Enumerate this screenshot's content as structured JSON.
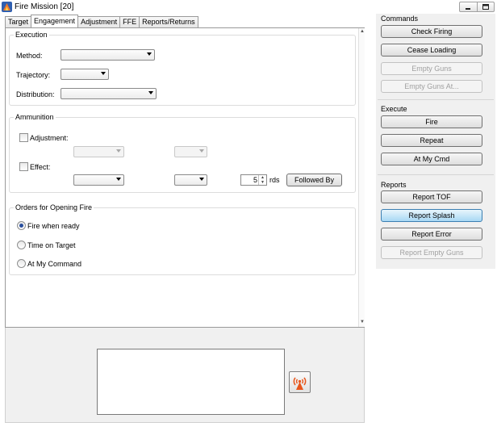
{
  "window": {
    "title": "Fire Mission [20]"
  },
  "tabs": [
    {
      "label": "Target"
    },
    {
      "label": "Engagement"
    },
    {
      "label": "Adjustment"
    },
    {
      "label": "FFE"
    },
    {
      "label": "Reports/Returns"
    }
  ],
  "execution": {
    "title": "Execution",
    "method_label": "Method:",
    "trajectory_label": "Trajectory:",
    "distribution_label": "Distribution:",
    "method_value": "",
    "trajectory_value": "",
    "distribution_value": ""
  },
  "ammunition": {
    "title": "Ammunition",
    "adjustment_label": "Adjustment:",
    "effect_label": "Effect:",
    "rounds_value": "5",
    "rounds_unit": "rds",
    "followed_by_label": "Followed By"
  },
  "orders": {
    "title": "Orders for Opening Fire",
    "options": [
      {
        "label": "Fire when ready",
        "checked": true
      },
      {
        "label": "Time on Target",
        "checked": false
      },
      {
        "label": "At My Command",
        "checked": false
      }
    ]
  },
  "commands": {
    "title": "Commands",
    "check_firing": "Check Firing",
    "cease_loading": "Cease Loading",
    "empty_guns": "Empty Guns",
    "empty_guns_at": "Empty Guns At..."
  },
  "execute": {
    "title": "Execute",
    "fire": "Fire",
    "repeat": "Repeat",
    "at_my_cmd": "At My Cmd"
  },
  "reports": {
    "title": "Reports",
    "report_tof": "Report TOF",
    "report_splash": "Report Splash",
    "report_error": "Report Error",
    "report_empty_guns": "Report Empty Guns"
  },
  "colors": {
    "highlight_button": "#a8d8f4",
    "panel_background": "#f0f0f0",
    "antenna_icon": "#e8561c"
  }
}
